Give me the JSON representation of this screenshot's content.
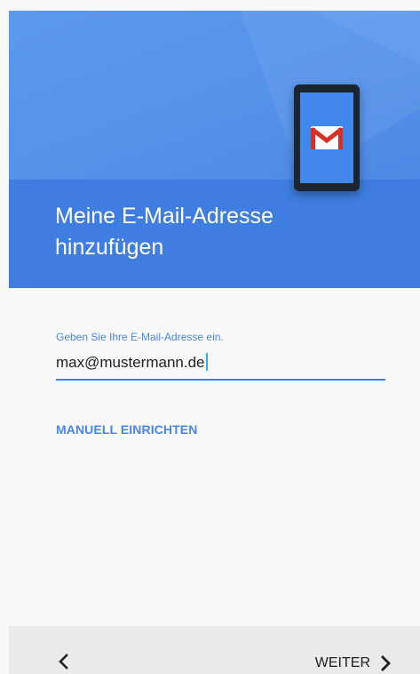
{
  "header": {
    "title": "Meine E-Mail-Adresse hinzufügen",
    "illustration_icon": "gmail-phone-icon",
    "colors": {
      "upper": "#5592ea",
      "lower": "#3f7de0"
    }
  },
  "form": {
    "label": "Geben Sie Ihre E-Mail-Adresse ein.",
    "email_value": "max@mustermann.de",
    "manual_setup_label": "MANUELL EINRICHTEN"
  },
  "bottom_bar": {
    "back_icon": "chevron-left-icon",
    "next_label": "WEITER",
    "next_icon": "chevron-right-icon"
  },
  "colors": {
    "accent": "#4a86e8",
    "background": "#f8f8f8",
    "bottom_bar": "#e9eaec"
  }
}
